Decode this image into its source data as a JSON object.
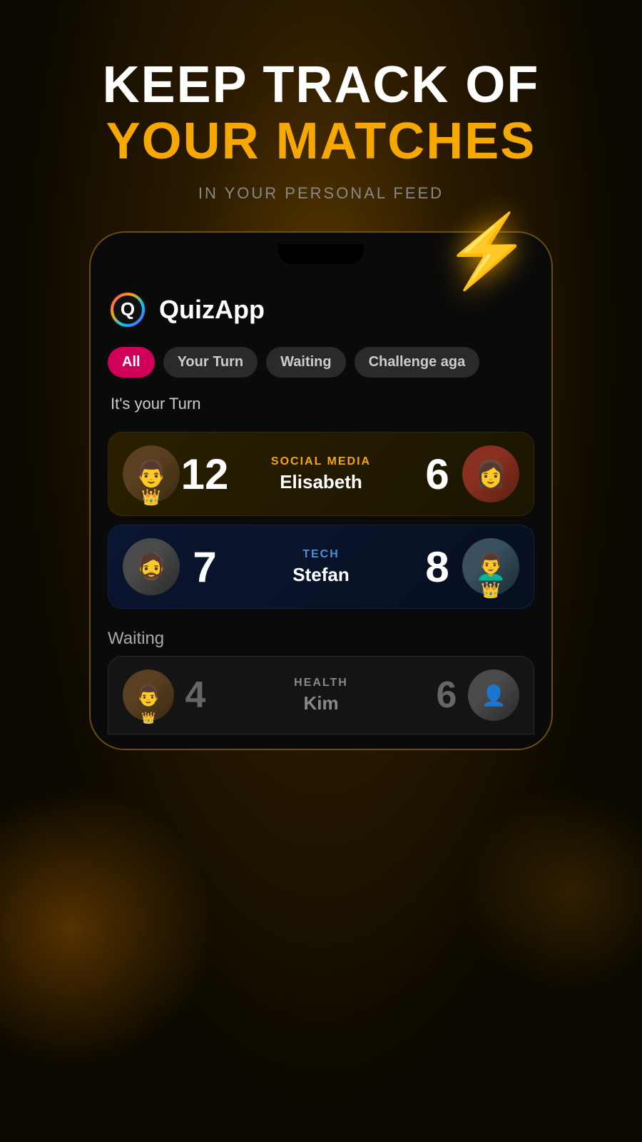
{
  "header": {
    "line1": "KEEP TRACK OF",
    "line2": "YOUR MATCHES",
    "subtitle": "IN YOUR PERSONAL FEED"
  },
  "app": {
    "name": "QuizApp"
  },
  "tabs": [
    {
      "label": "All",
      "active": true
    },
    {
      "label": "Your Turn",
      "active": false
    },
    {
      "label": "Waiting",
      "active": false
    },
    {
      "label": "Challenge aga",
      "active": false
    }
  ],
  "your_turn_label": "It's your Turn",
  "matches": [
    {
      "category": "SOCIAL MEDIA",
      "opponent": "Elisabeth",
      "my_score": "12",
      "opp_score": "6",
      "my_crown": true,
      "opp_crown": false,
      "card_type": "gold"
    },
    {
      "category": "TECH",
      "opponent": "Stefan",
      "my_score": "7",
      "opp_score": "8",
      "my_crown": false,
      "opp_crown": true,
      "card_type": "blue"
    }
  ],
  "waiting_label": "Waiting",
  "waiting_match": {
    "category": "HEALTH",
    "opponent": "Kim",
    "my_score": "4",
    "opp_score": "6",
    "card_type": "dark"
  },
  "lightning_icon": "⚡"
}
